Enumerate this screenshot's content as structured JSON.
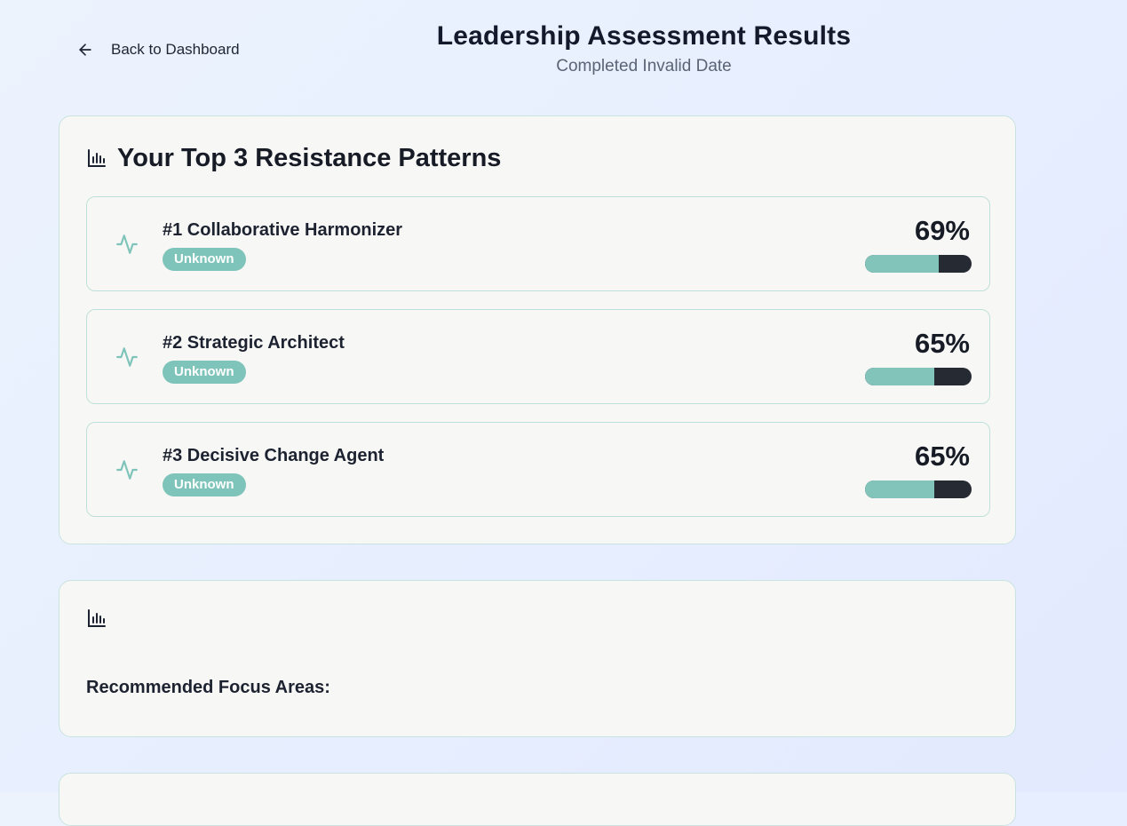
{
  "nav": {
    "back_label": "Back to Dashboard"
  },
  "header": {
    "title": "Leadership Assessment Results",
    "subtitle": "Completed Invalid Date"
  },
  "patterns_card": {
    "title": "Your Top 3 Resistance Patterns",
    "items": [
      {
        "name": "#1 Collaborative Harmonizer",
        "badge": "Unknown",
        "percent_label": "69%",
        "progress": 0.69
      },
      {
        "name": "#2 Strategic Architect",
        "badge": "Unknown",
        "percent_label": "65%",
        "progress": 0.65
      },
      {
        "name": "#3 Decisive Change Agent",
        "badge": "Unknown",
        "percent_label": "65%",
        "progress": 0.65
      }
    ]
  },
  "focus_card": {
    "label": "Recommended Focus Areas:"
  },
  "icons": {
    "back": "arrow-left-icon",
    "chart": "bar-chart-icon",
    "pattern": "activity-pulse-icon"
  },
  "colors": {
    "accent": "#7fc4ba",
    "bar_track": "#262a33",
    "card_border": "#c9e3e0"
  }
}
